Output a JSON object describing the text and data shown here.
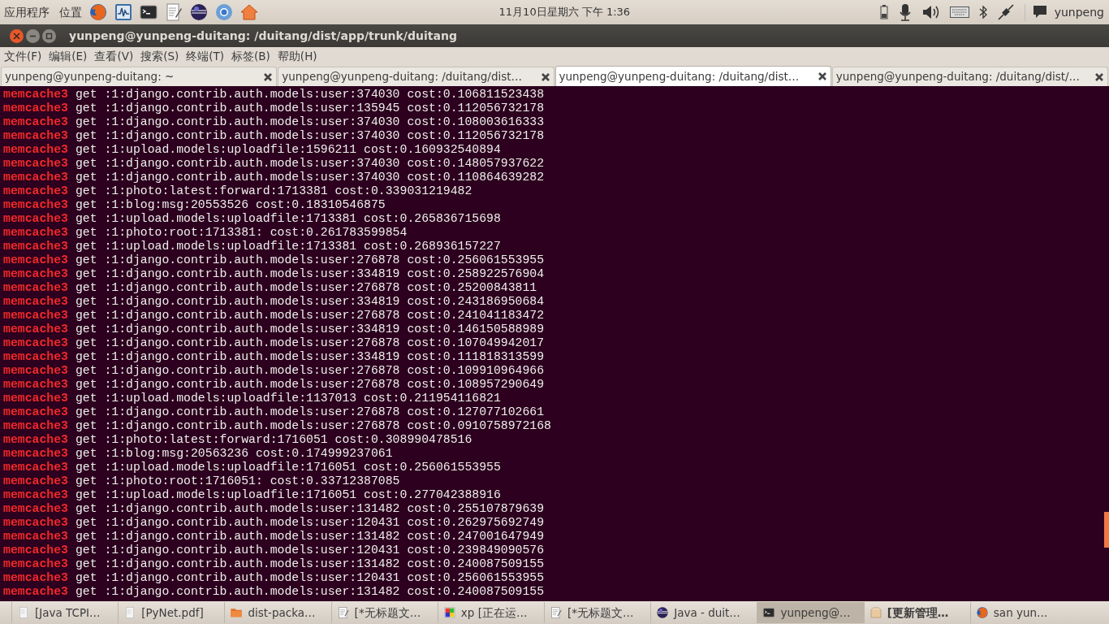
{
  "top_panel": {
    "menus": [
      "应用程序",
      "位置"
    ],
    "launchers": [
      {
        "kind": "firefox"
      },
      {
        "kind": "monitor"
      },
      {
        "kind": "terminal"
      },
      {
        "kind": "editor"
      },
      {
        "kind": "eclipse"
      },
      {
        "kind": "chromium"
      },
      {
        "kind": "home"
      }
    ],
    "clock": "11月10日星期六 下午 1:36",
    "user": "yunpeng"
  },
  "window": {
    "title": "yunpeng@yunpeng-duitang: /duitang/dist/app/trunk/duitang"
  },
  "menu_bar": [
    "文件(F)",
    "编辑(E)",
    "查看(V)",
    "搜索(S)",
    "终端(T)",
    "标签(B)",
    "帮助(H)"
  ],
  "tabs": [
    {
      "label": "yunpeng@yunpeng-duitang: ~",
      "selected": false
    },
    {
      "label": "yunpeng@yunpeng-duitang: /duitang/dist…",
      "selected": false
    },
    {
      "label": "yunpeng@yunpeng-duitang: /duitang/dist…",
      "selected": true
    },
    {
      "label": "yunpeng@yunpeng-duitang: /duitang/dist/…",
      "selected": false
    }
  ],
  "terminal": {
    "lines": [
      {
        "tag": "memcache3",
        "text": "get :1:django.contrib.auth.models:user:374030 cost:0.106811523438"
      },
      {
        "tag": "memcache3",
        "text": "get :1:django.contrib.auth.models:user:135945 cost:0.112056732178"
      },
      {
        "tag": "memcache3",
        "text": "get :1:django.contrib.auth.models:user:374030 cost:0.108003616333"
      },
      {
        "tag": "memcache3",
        "text": "get :1:django.contrib.auth.models:user:374030 cost:0.112056732178"
      },
      {
        "tag": "memcache3",
        "text": "get :1:upload.models:uploadfile:1596211 cost:0.160932540894"
      },
      {
        "tag": "memcache3",
        "text": "get :1:django.contrib.auth.models:user:374030 cost:0.148057937622"
      },
      {
        "tag": "memcache3",
        "text": "get :1:django.contrib.auth.models:user:374030 cost:0.110864639282"
      },
      {
        "tag": "memcache3",
        "text": "get :1:photo:latest:forward:1713381 cost:0.339031219482"
      },
      {
        "tag": "memcache3",
        "text": "get :1:blog:msg:20553526 cost:0.18310546875"
      },
      {
        "tag": "memcache3",
        "text": "get :1:upload.models:uploadfile:1713381 cost:0.265836715698"
      },
      {
        "tag": "memcache3",
        "text": "get :1:photo:root:1713381: cost:0.261783599854"
      },
      {
        "tag": "memcache3",
        "text": "get :1:upload.models:uploadfile:1713381 cost:0.268936157227"
      },
      {
        "tag": "memcache3",
        "text": "get :1:django.contrib.auth.models:user:276878 cost:0.256061553955"
      },
      {
        "tag": "memcache3",
        "text": "get :1:django.contrib.auth.models:user:334819 cost:0.258922576904"
      },
      {
        "tag": "memcache3",
        "text": "get :1:django.contrib.auth.models:user:276878 cost:0.25200843811"
      },
      {
        "tag": "memcache3",
        "text": "get :1:django.contrib.auth.models:user:334819 cost:0.243186950684"
      },
      {
        "tag": "memcache3",
        "text": "get :1:django.contrib.auth.models:user:276878 cost:0.241041183472"
      },
      {
        "tag": "memcache3",
        "text": "get :1:django.contrib.auth.models:user:334819 cost:0.146150588989"
      },
      {
        "tag": "memcache3",
        "text": "get :1:django.contrib.auth.models:user:276878 cost:0.107049942017"
      },
      {
        "tag": "memcache3",
        "text": "get :1:django.contrib.auth.models:user:334819 cost:0.111818313599"
      },
      {
        "tag": "memcache3",
        "text": "get :1:django.contrib.auth.models:user:276878 cost:0.109910964966"
      },
      {
        "tag": "memcache3",
        "text": "get :1:django.contrib.auth.models:user:276878 cost:0.108957290649"
      },
      {
        "tag": "memcache3",
        "text": "get :1:upload.models:uploadfile:1137013 cost:0.211954116821"
      },
      {
        "tag": "memcache3",
        "text": "get :1:django.contrib.auth.models:user:276878 cost:0.127077102661"
      },
      {
        "tag": "memcache3",
        "text": "get :1:django.contrib.auth.models:user:276878 cost:0.0910758972168"
      },
      {
        "tag": "memcache3",
        "text": "get :1:photo:latest:forward:1716051 cost:0.308990478516"
      },
      {
        "tag": "memcache3",
        "text": "get :1:blog:msg:20563236 cost:0.174999237061"
      },
      {
        "tag": "memcache3",
        "text": "get :1:upload.models:uploadfile:1716051 cost:0.256061553955"
      },
      {
        "tag": "memcache3",
        "text": "get :1:photo:root:1716051: cost:0.33712387085"
      },
      {
        "tag": "memcache3",
        "text": "get :1:upload.models:uploadfile:1716051 cost:0.277042388916"
      },
      {
        "tag": "memcache3",
        "text": "get :1:django.contrib.auth.models:user:131482 cost:0.255107879639"
      },
      {
        "tag": "memcache3",
        "text": "get :1:django.contrib.auth.models:user:120431 cost:0.262975692749"
      },
      {
        "tag": "memcache3",
        "text": "get :1:django.contrib.auth.models:user:131482 cost:0.247001647949"
      },
      {
        "tag": "memcache3",
        "text": "get :1:django.contrib.auth.models:user:120431 cost:0.239849090576"
      },
      {
        "tag": "memcache3",
        "text": "get :1:django.contrib.auth.models:user:131482 cost:0.240087509155"
      },
      {
        "tag": "memcache3",
        "text": "get :1:django.contrib.auth.models:user:120431 cost:0.256061553955"
      },
      {
        "tag": "memcache3",
        "text": "get :1:django.contrib.auth.models:user:131482 cost:0.240087509155"
      }
    ]
  },
  "taskbar": [
    {
      "kind": "document",
      "label": "[Java TCPI…",
      "selected": false,
      "attention": false
    },
    {
      "kind": "document",
      "label": "[PyNet.pdf]",
      "selected": false,
      "attention": false
    },
    {
      "kind": "folder",
      "label": "dist-packa…",
      "selected": false,
      "attention": false
    },
    {
      "kind": "editor",
      "label": "[*无标题文…",
      "selected": false,
      "attention": false
    },
    {
      "kind": "vm",
      "label": "xp [正在运…",
      "selected": false,
      "attention": false
    },
    {
      "kind": "editor",
      "label": "[*无标题文…",
      "selected": false,
      "attention": false
    },
    {
      "kind": "eclipse",
      "label": "Java - duit…",
      "selected": false,
      "attention": false
    },
    {
      "kind": "terminal",
      "label": "yunpeng@…",
      "selected": true,
      "attention": false
    },
    {
      "kind": "package",
      "label": "[更新管理…",
      "selected": false,
      "attention": true
    },
    {
      "kind": "firefox",
      "label": "san yun…",
      "selected": false,
      "attention": false
    }
  ]
}
